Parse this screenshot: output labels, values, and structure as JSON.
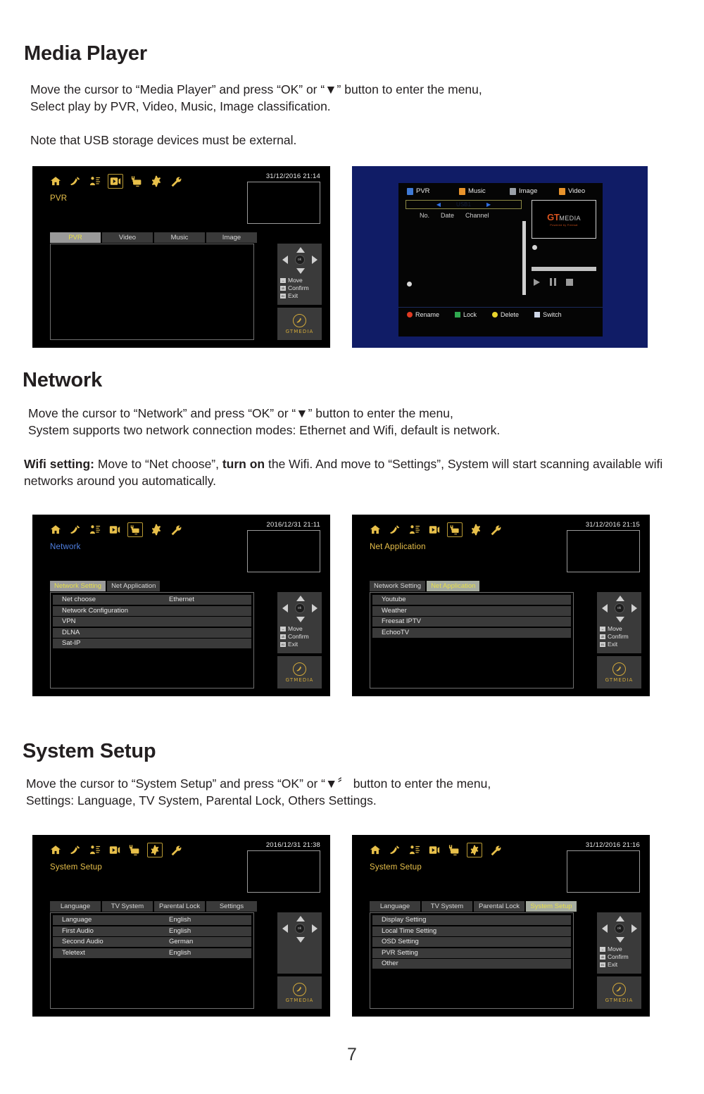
{
  "page": {
    "number": "7"
  },
  "sections": [
    {
      "id": "media-player",
      "title": "Media Player",
      "paragraphs": [
        "Move the cursor to “Media Player” and press “OK” or “▼” button to enter the menu,\nSelect play by PVR, Video, Music, Image classification.",
        "Note that USB storage devices must be external."
      ]
    },
    {
      "id": "network",
      "title": "Network",
      "paragraphs": [
        "Move the cursor to “Network” and press “OK” or “▼” button to enter the menu,\nSystem supports two network connection modes: Ethernet and Wifi, default is network.",
        "Wifi setting: Move to “Net choose”, turn on the Wifi. And move to “Settings”, System will start scanning available wifi networks around you automatically."
      ],
      "rich": {
        "lead_bold": "Wifi setting:",
        "rest_a": " Move to “Net choose”, ",
        "mid_bold": "turn on",
        "rest_b": " the Wifi. And move to “Settings”, System will start scanning available wifi networks around you automatically."
      }
    },
    {
      "id": "system-setup",
      "title": "System Setup",
      "paragraphs": [
        "Move the cursor to “System Setup” and press “OK” or “▼〞 button to enter the menu,\nSettings: Language, TV System, Parental Lock, Others Settings."
      ]
    }
  ],
  "icon_bar": [
    {
      "name": "home-icon",
      "label": "Home"
    },
    {
      "name": "satellite-dish-icon",
      "label": "Satellite"
    },
    {
      "name": "channel-list-icon",
      "label": "Channel"
    },
    {
      "name": "media-player-icon",
      "label": "Media Player"
    },
    {
      "name": "network-icon",
      "label": "Network"
    },
    {
      "name": "system-setup-icon",
      "label": "System Setup"
    },
    {
      "name": "tools-icon",
      "label": "Tools"
    }
  ],
  "help_panel": {
    "move": "Move",
    "confirm": "Confirm",
    "exit": "Exit",
    "move_key": "◄►",
    "confirm_key": "ok",
    "exit_key": "exit"
  },
  "brand": {
    "name": "GTMEDIA"
  },
  "screens": {
    "pvr": {
      "title": "PVR",
      "datetime": "31/12/2016  21:14",
      "selected_icon_index": 3,
      "tabs": [
        {
          "label": "PVR",
          "active": true
        },
        {
          "label": "Video",
          "active": false
        },
        {
          "label": "Music",
          "active": false
        },
        {
          "label": "Image",
          "active": false
        }
      ],
      "items": []
    },
    "media_player_blue": {
      "tabs": [
        {
          "label": "PVR",
          "color": "#3f7ad6"
        },
        {
          "label": "Music",
          "color": "#e8932c"
        },
        {
          "label": "Image",
          "color": "#9aa0a8"
        },
        {
          "label": "Video",
          "color": "#e8932c"
        }
      ],
      "search_label": "USB1",
      "columns": [
        "No.",
        "Date",
        "Channel"
      ],
      "logo": {
        "gt": "GT",
        "media": "MEDIA",
        "powered": "Powered by Freesat"
      },
      "color_buttons": [
        {
          "label": "Rename",
          "color": "#e03a22"
        },
        {
          "label": "Lock",
          "color": "#2fa84f"
        },
        {
          "label": "Delete",
          "color": "#e8d42c"
        },
        {
          "label": "Switch",
          "color": "#cfd8e8"
        }
      ],
      "transport": [
        "play",
        "pause",
        "stop"
      ]
    },
    "network_setting": {
      "title": "Network",
      "datetime": "2016/12/31  21:11",
      "selected_icon_index": 4,
      "tabs": [
        {
          "label": "Network Setting",
          "active": true
        },
        {
          "label": "Net Application",
          "active": false
        }
      ],
      "items": [
        {
          "label": "Net choose",
          "value": "Ethernet"
        },
        {
          "label": "Network Configuration",
          "value": ""
        },
        {
          "label": "VPN",
          "value": ""
        },
        {
          "label": "DLNA",
          "value": ""
        },
        {
          "label": "Sat-IP",
          "value": ""
        }
      ]
    },
    "net_application": {
      "title": "Net Application",
      "datetime": "31/12/2016  21:15",
      "selected_icon_index": 4,
      "tabs": [
        {
          "label": "Network Setting",
          "active": false
        },
        {
          "label": "Net Application",
          "active": true
        }
      ],
      "items": [
        {
          "label": "Youtube",
          "value": ""
        },
        {
          "label": "Weather",
          "value": ""
        },
        {
          "label": "Freesat IPTV",
          "value": ""
        },
        {
          "label": "EchooTV",
          "value": ""
        }
      ]
    },
    "system_language": {
      "title": "System Setup",
      "datetime": "2016/12/31  21:38",
      "selected_icon_index": 5,
      "tabs": [
        {
          "label": "Language",
          "active": false
        },
        {
          "label": "TV System",
          "active": false
        },
        {
          "label": "Parental Lock",
          "active": false
        },
        {
          "label": "Settings",
          "active": false
        }
      ],
      "items": [
        {
          "label": "Language",
          "value": "English"
        },
        {
          "label": "First Audio",
          "value": "English"
        },
        {
          "label": "Second Audio",
          "value": "German"
        },
        {
          "label": "Teletext",
          "value": "English"
        }
      ],
      "show_help_text": false
    },
    "system_setup": {
      "title": "System Setup",
      "datetime": "31/12/2016  21:16",
      "selected_icon_index": 5,
      "tabs": [
        {
          "label": "Language",
          "active": false
        },
        {
          "label": "TV System",
          "active": false
        },
        {
          "label": "Parental Lock",
          "active": false
        },
        {
          "label": "System Setup",
          "active": true
        }
      ],
      "items": [
        {
          "label": "Display Setting",
          "value": ""
        },
        {
          "label": "Local Time Setting",
          "value": ""
        },
        {
          "label": "OSD Setting",
          "value": ""
        },
        {
          "label": "PVR Setting",
          "value": ""
        },
        {
          "label": "Other",
          "value": ""
        }
      ],
      "show_help_text": true
    }
  },
  "colors": {
    "accent_gold": "#e8c04a",
    "osd_bg": "#000000",
    "blue_bg": "#101c66",
    "panel_grey": "#3a3a3a",
    "tab_active": "#a6aca0"
  }
}
